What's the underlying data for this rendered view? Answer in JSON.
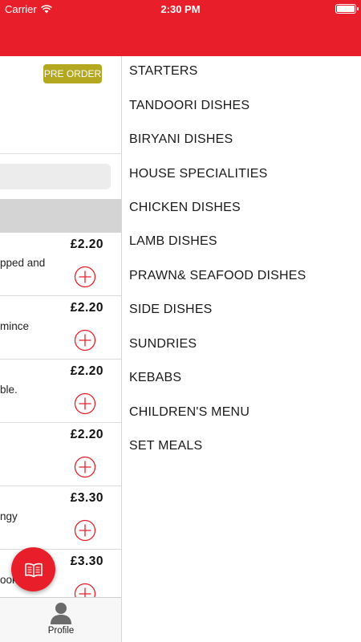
{
  "status_bar": {
    "carrier": "Carrier",
    "time": "2:30 PM"
  },
  "main": {
    "pre_order_label": "PRE ORDER",
    "items": [
      {
        "price": "£2.20",
        "desc": "pped and"
      },
      {
        "price": "£2.20",
        "desc": "mince"
      },
      {
        "price": "£2.20",
        "desc": "ble."
      },
      {
        "price": "£2.20",
        "desc": ""
      },
      {
        "price": "£3.30",
        "desc": "ngy"
      },
      {
        "price": "£3.30",
        "desc": "ooked"
      }
    ]
  },
  "bottom_bar": {
    "profile_label": "Profile"
  },
  "drawer": {
    "categories": [
      "STARTERS",
      "TANDOORI DISHES",
      "BIRYANI DISHES",
      "HOUSE SPECIALITIES",
      "CHICKEN DISHES",
      "LAMB DISHES",
      "PRAWN& SEAFOOD DISHES",
      "SIDE DISHES",
      "SUNDRIES",
      "KEBABS",
      "CHILDREN'S MENU",
      "SET MEALS"
    ]
  },
  "colors": {
    "brand_red": "#e81f2a",
    "pre_order_olive": "#b3a81f"
  },
  "icons": {
    "wifi": "wifi-icon",
    "battery": "battery-icon",
    "add": "add-circle-icon",
    "menu_book": "menu-book-icon",
    "profile": "profile-icon"
  }
}
